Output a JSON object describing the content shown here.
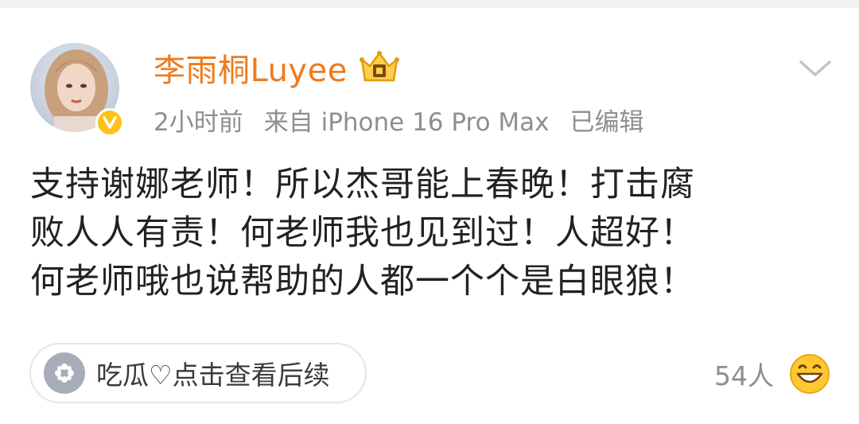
{
  "post": {
    "author": {
      "name": "李雨桐Luyee",
      "avatar_icon": "avatar",
      "badge_icon": "crown-icon",
      "verified_icon": "verified-v-icon",
      "name_color": "#f07a1b"
    },
    "meta": {
      "time": "2小时前",
      "source": "来自 iPhone 16 Pro Max",
      "edited": "已编辑"
    },
    "menu_icon": "chevron-down-icon",
    "content_lines": [
      "支持谢娜老师！所以杰哥能上春晚！打击腐",
      "败人人有责！何老师我也见到过！人超好！",
      "何老师哦也说帮助的人都一个个是白眼狼！"
    ],
    "topic": {
      "icon": "melon-icon",
      "label": "吃瓜♡点击查看后续"
    },
    "reactions": {
      "count": "54人",
      "icon": "grin-emoji-icon"
    }
  }
}
